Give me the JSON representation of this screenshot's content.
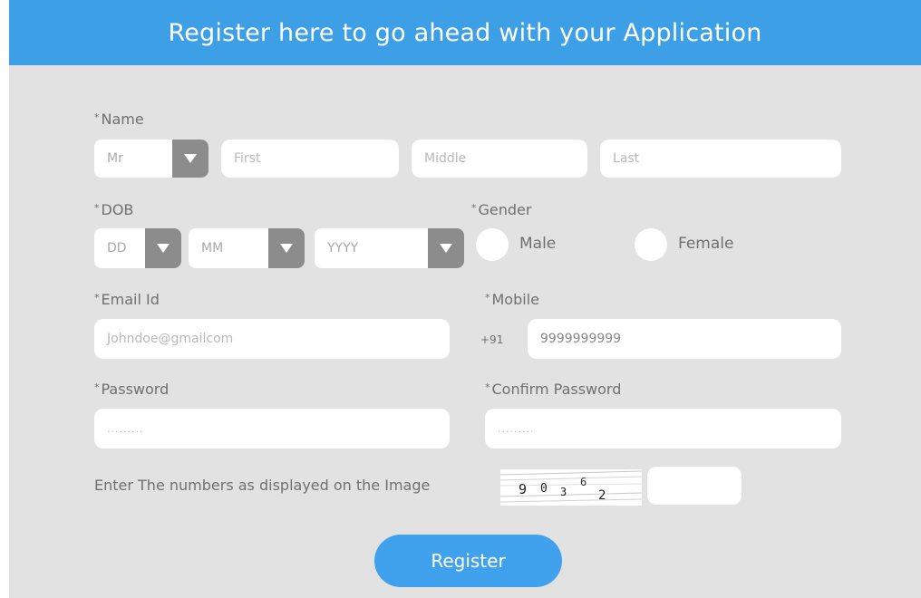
{
  "header": {
    "title": "Register here to go ahead with your Application"
  },
  "form": {
    "required_mark": "*",
    "name": {
      "label": "Name",
      "title_value": "Mr",
      "first_placeholder": "First",
      "middle_placeholder": "Middle",
      "last_placeholder": "Last"
    },
    "dob": {
      "label": "DOB",
      "day_value": "DD",
      "month_value": "MM",
      "year_value": "YYYY"
    },
    "gender": {
      "label": "Gender",
      "options": [
        "Male",
        "Female"
      ]
    },
    "email": {
      "label": "Email Id",
      "placeholder": "Johndoe@gmailcom"
    },
    "mobile": {
      "label": "Mobile",
      "prefix": "+91",
      "placeholder": "9999999999"
    },
    "password": {
      "label": "Password",
      "placeholder": "........."
    },
    "confirm_password": {
      "label": "Confirm Password",
      "placeholder": "........."
    },
    "captcha": {
      "prompt": "Enter The numbers as displayed on the Image",
      "digits": [
        "9",
        "0",
        "3",
        "6",
        "2"
      ]
    },
    "register_label": "Register"
  },
  "colors": {
    "header": "#3d9fe6",
    "panel": "#e2e2e2",
    "button": "#40a2ec",
    "dropdown_arrow": "#8c8c8c"
  },
  "icons": {
    "dropdown": "caret-down-icon"
  }
}
